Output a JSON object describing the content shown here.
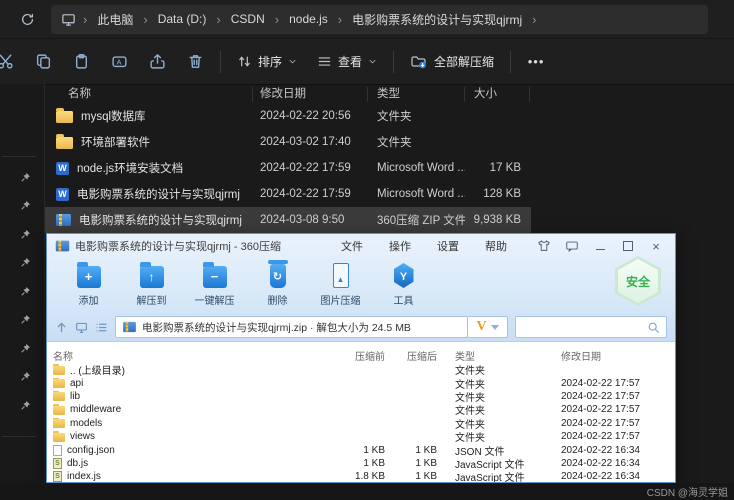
{
  "explorer": {
    "breadcrumb": {
      "crumbs": [
        {
          "label": "此电脑"
        },
        {
          "label": "Data (D:)"
        },
        {
          "label": "CSDN"
        },
        {
          "label": "node.js"
        },
        {
          "label": "电影购票系统的设计与实现qjrmj"
        }
      ]
    },
    "toolbar": {
      "sort_label": "排序",
      "view_label": "查看",
      "extract_label": "全部解压缩",
      "more_label": "•••"
    },
    "columns": [
      "名称",
      "修改日期",
      "类型",
      "大小"
    ],
    "files": [
      {
        "name": "mysql数据库",
        "date": "2024-02-22 20:56",
        "type": "文件夹",
        "size": "",
        "icon": "folder"
      },
      {
        "name": "环境部署软件",
        "date": "2024-03-02 17:40",
        "type": "文件夹",
        "size": "",
        "icon": "folder"
      },
      {
        "name": "node.js环境安装文档",
        "date": "2024-02-22 17:59",
        "type": "Microsoft Word ...",
        "size": "17 KB",
        "icon": "word"
      },
      {
        "name": "电影购票系统的设计与实现qjrmj",
        "date": "2024-02-22 17:59",
        "type": "Microsoft Word ...",
        "size": "128 KB",
        "icon": "word"
      },
      {
        "name": "电影购票系统的设计与实现qjrmj",
        "date": "2024-03-08 9:50",
        "type": "360压缩 ZIP 文件",
        "size": "9,938 KB",
        "icon": "zip",
        "selected": true
      }
    ]
  },
  "zip_window": {
    "title": "电影购票系统的设计与实现qjrmj - 360压缩",
    "menus": [
      {
        "label": "文件"
      },
      {
        "label": "操作"
      },
      {
        "label": "设置"
      },
      {
        "label": "帮助"
      }
    ],
    "tools": [
      {
        "label": "添加",
        "icon": "add"
      },
      {
        "label": "解压到",
        "icon": "extract"
      },
      {
        "label": "一键解压",
        "icon": "onekey"
      },
      {
        "label": "删除",
        "icon": "delete"
      },
      {
        "label": "图片压缩",
        "icon": "image"
      },
      {
        "label": "工具",
        "icon": "tools"
      }
    ],
    "safe_badge": "安全",
    "address": "电影购票系统的设计与实现qjrmj.zip · 解包大小为 24.5 MB",
    "vip_label": "V",
    "columns": [
      "名称",
      "压缩前",
      "压缩后",
      "类型",
      "修改日期"
    ],
    "entries": [
      {
        "name": ".. (上级目录)",
        "before": "",
        "after": "",
        "type": "文件夹",
        "date": "",
        "icon": "folder-up"
      },
      {
        "name": "api",
        "before": "",
        "after": "",
        "type": "文件夹",
        "date": "2024-02-22 17:57",
        "icon": "folder"
      },
      {
        "name": "lib",
        "before": "",
        "after": "",
        "type": "文件夹",
        "date": "2024-02-22 17:57",
        "icon": "folder"
      },
      {
        "name": "middleware",
        "before": "",
        "after": "",
        "type": "文件夹",
        "date": "2024-02-22 17:57",
        "icon": "folder"
      },
      {
        "name": "models",
        "before": "",
        "after": "",
        "type": "文件夹",
        "date": "2024-02-22 17:57",
        "icon": "folder"
      },
      {
        "name": "views",
        "before": "",
        "after": "",
        "type": "文件夹",
        "date": "2024-02-22 17:57",
        "icon": "folder"
      },
      {
        "name": "config.json",
        "before": "1 KB",
        "after": "1 KB",
        "type": "JSON 文件",
        "date": "2024-02-22 16:34",
        "icon": "file"
      },
      {
        "name": "db.js",
        "before": "1 KB",
        "after": "1 KB",
        "type": "JavaScript 文件",
        "date": "2024-02-22 16:34",
        "icon": "js"
      },
      {
        "name": "index.js",
        "before": "1.8 KB",
        "after": "1 KB",
        "type": "JavaScript 文件",
        "date": "2024-02-22 16:34",
        "icon": "js"
      }
    ]
  },
  "watermark": "CSDN @海灵学姐",
  "colors": {
    "accent_blue": "#1b77d4",
    "folder_yellow": "#e9b84f",
    "safe_green": "#33b14c",
    "vip_orange": "#f59a23",
    "selection_gray": "#3b3b3b"
  }
}
